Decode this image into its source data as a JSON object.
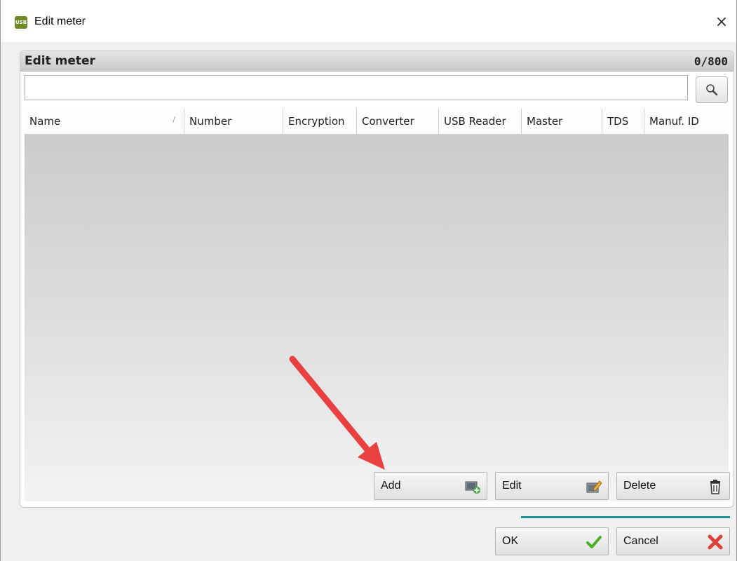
{
  "window": {
    "title": "Edit meter",
    "app_icon_text": "USB",
    "close_glyph": "×"
  },
  "panel": {
    "title": "Edit meter",
    "count": "0/800"
  },
  "search": {
    "value": "",
    "placeholder": "",
    "icon": "magnifier-icon"
  },
  "table": {
    "columns": [
      "Name",
      "Number",
      "Encryption",
      "Converter",
      "USB Reader",
      "Master",
      "TDS",
      "Manuf. ID"
    ],
    "sorted_column": "Name",
    "rows": []
  },
  "actions": {
    "add_label": "Add",
    "edit_label": "Edit",
    "delete_label": "Delete"
  },
  "dialog": {
    "ok_label": "OK",
    "cancel_label": "Cancel"
  },
  "colors": {
    "accent_line": "#1f8f8f",
    "annotation_arrow": "#e8413f"
  }
}
